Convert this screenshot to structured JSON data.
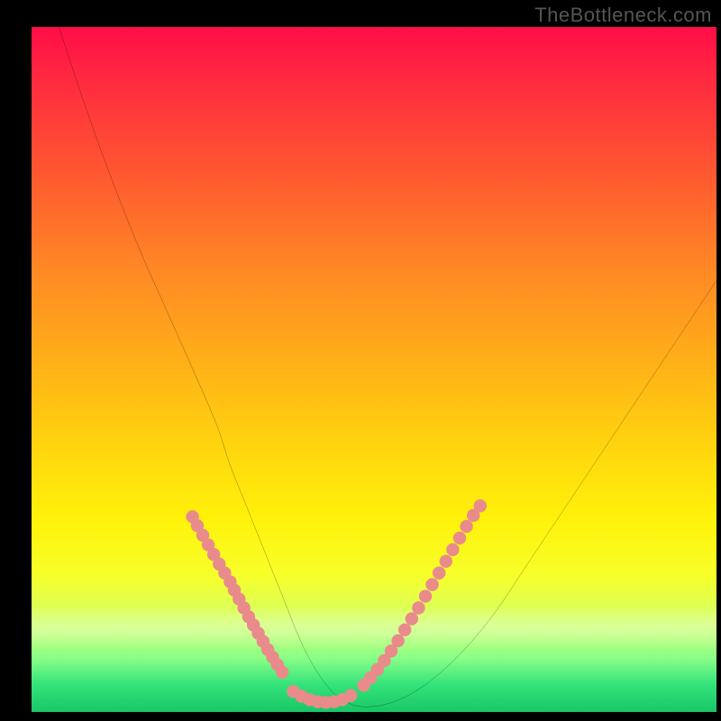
{
  "watermark": "TheBottleneck.com",
  "chart_data": {
    "type": "line",
    "title": "",
    "xlabel": "",
    "ylabel": "",
    "x_range": [
      0,
      100
    ],
    "y_range": [
      0,
      100
    ],
    "series": [
      {
        "name": "bottleneck-curve",
        "x": [
          4,
          8,
          12,
          16,
          20,
          24,
          27,
          29,
          31,
          33,
          35,
          37,
          39,
          41,
          43,
          45,
          48,
          52,
          56,
          60,
          64,
          68,
          72,
          76,
          80,
          84,
          88,
          92,
          96,
          100
        ],
        "y": [
          100,
          88,
          77,
          67,
          58,
          49,
          42,
          36,
          31,
          26,
          21,
          16,
          11,
          7,
          4,
          2,
          0.8,
          1.2,
          3,
          6,
          10,
          15,
          21,
          27,
          33,
          39,
          45,
          51,
          57,
          63
        ]
      }
    ],
    "highlights_left": {
      "name": "left-branch-highlight-dots",
      "x": [
        23.5,
        24.2,
        25.0,
        25.8,
        26.6,
        27.4,
        28.2,
        29.0,
        29.6,
        30.3,
        31.0,
        31.7,
        32.4,
        33.1,
        33.8,
        34.5,
        35.2,
        35.9,
        36.6
      ],
      "y": [
        28.5,
        27.2,
        25.8,
        24.4,
        23.0,
        21.6,
        20.3,
        19.0,
        17.8,
        16.5,
        15.2,
        13.9,
        12.7,
        11.5,
        10.3,
        9.1,
        8.0,
        6.9,
        5.8
      ]
    },
    "highlights_right": {
      "name": "right-branch-highlight-dots",
      "x": [
        48.5,
        49.5,
        50.5,
        51.5,
        52.5,
        53.5,
        54.5,
        55.5,
        56.5,
        57.5,
        58.5,
        59.5,
        60.5,
        61.5,
        62.5,
        63.5,
        64.5,
        65.5
      ],
      "y": [
        3.9,
        5.0,
        6.2,
        7.5,
        8.9,
        10.4,
        12.0,
        13.6,
        15.2,
        16.9,
        18.6,
        20.3,
        22.0,
        23.7,
        25.4,
        27.1,
        28.7,
        30.1
      ]
    },
    "highlights_valley": {
      "name": "valley-highlight-dots",
      "x": [
        38.2,
        39.4,
        40.6,
        41.8,
        43.0,
        44.2,
        45.4,
        46.6
      ],
      "y": [
        3.0,
        2.3,
        1.8,
        1.5,
        1.4,
        1.5,
        1.8,
        2.4
      ]
    },
    "colors": {
      "curve": "#000000",
      "dots": "#e98b8b",
      "background_top": "#ff0d47",
      "background_bottom": "#18c765"
    }
  }
}
